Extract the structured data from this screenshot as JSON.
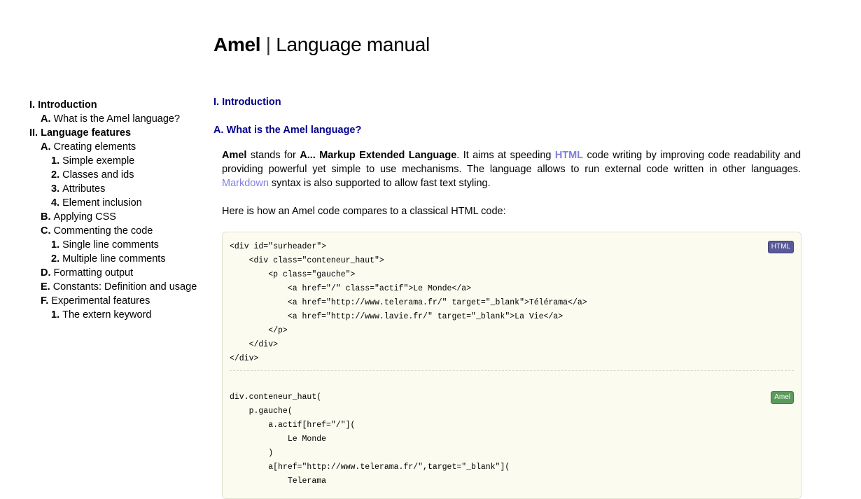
{
  "header": {
    "brand": "Amel",
    "separator": "|",
    "subtitle": "Language manual"
  },
  "toc": [
    {
      "level": 1,
      "num": "I.",
      "label": "Introduction"
    },
    {
      "level": 2,
      "num": "A.",
      "label": "What is the Amel language?"
    },
    {
      "level": 1,
      "num": "II.",
      "label": "Language features"
    },
    {
      "level": 2,
      "num": "A.",
      "label": "Creating elements"
    },
    {
      "level": 3,
      "num": "1.",
      "label": "Simple exemple"
    },
    {
      "level": 3,
      "num": "2.",
      "label": "Classes and ids"
    },
    {
      "level": 3,
      "num": "3.",
      "label": "Attributes"
    },
    {
      "level": 3,
      "num": "4.",
      "label": "Element inclusion"
    },
    {
      "level": 2,
      "num": "B.",
      "label": "Applying CSS"
    },
    {
      "level": 2,
      "num": "C.",
      "label": "Commenting the code"
    },
    {
      "level": 3,
      "num": "1.",
      "label": "Single line comments"
    },
    {
      "level": 3,
      "num": "2.",
      "label": "Multiple line comments"
    },
    {
      "level": 2,
      "num": "D.",
      "label": "Formatting output"
    },
    {
      "level": 2,
      "num": "E.",
      "label": "Constants: Definition and usage"
    },
    {
      "level": 2,
      "num": "F.",
      "label": "Experimental features"
    },
    {
      "level": 3,
      "num": "1.",
      "label": "The extern keyword"
    }
  ],
  "content": {
    "section_heading": "I. Introduction",
    "subsection_heading": "A. What is the Amel language?",
    "intro": {
      "amel": "Amel",
      "stands_for": " stands for ",
      "acronym": "A... Markup Extended Language",
      "aims": ". It aims at speeding ",
      "html_link": "HTML",
      "rest1": " code writing by improving code readability and providing powerful yet simple to use mechanisms. The language allows to run external code written in other languages. ",
      "markdown_link": "Markdown",
      "rest2": " syntax is also supported to allow fast text styling."
    },
    "compare_text": "Here is how an Amel code compares to a classical HTML code:",
    "html_badge": "HTML",
    "amel_badge": "Amel",
    "html_code": "<div id=\"surheader\">\n    <div class=\"conteneur_haut\">\n        <p class=\"gauche\">\n            <a href=\"/\" class=\"actif\">Le Monde</a>\n            <a href=\"http://www.telerama.fr/\" target=\"_blank\">Télérama</a>\n            <a href=\"http://www.lavie.fr/\" target=\"_blank\">La Vie</a>\n        </p>\n    </div>\n</div>",
    "amel_code": "div.conteneur_haut(\n    p.gauche(\n        a.actif[href=\"/\"](\n            Le Monde\n        )\n        a[href=\"http://www.telerama.fr/\",target=\"_blank\"](\n            Telerama"
  }
}
